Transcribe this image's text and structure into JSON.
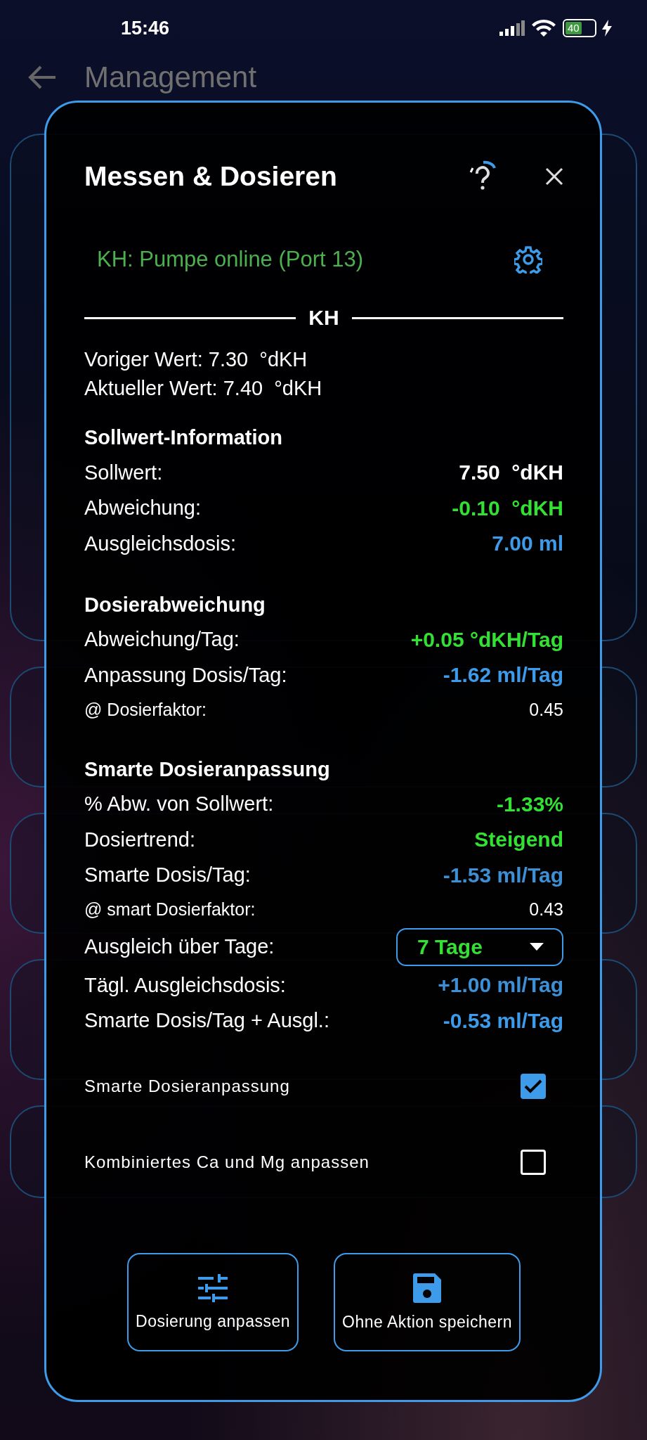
{
  "status_bar": {
    "time": "15:46",
    "battery": "40"
  },
  "header": {
    "title": "Management"
  },
  "dialog": {
    "title": "Messen & Dosieren",
    "status": "KH: Pumpe online (Port 13)",
    "divider_title": "KH",
    "readings": [
      "Voriger Wert: 7.30  °dKH",
      "Aktueller Wert: 7.40  °dKH"
    ],
    "sections": [
      {
        "title": "Sollwert-Information",
        "rows": [
          {
            "kind": "value",
            "label": "Sollwert:",
            "value": "7.50  °dKH",
            "color": "#ffffff"
          },
          {
            "kind": "value",
            "label": "Abweichung:",
            "value": "-0.10  °dKH",
            "color": "#33e033"
          },
          {
            "kind": "value",
            "label": "Ausgleichsdosis:",
            "value": "7.00 ml",
            "color": "#3d9be9"
          }
        ]
      },
      {
        "title": "Dosierabweichung",
        "rows": [
          {
            "kind": "value",
            "label": "Abweichung/Tag:",
            "value": "+0.05 °dKH/Tag",
            "color": "#33e033"
          },
          {
            "kind": "value",
            "label": "Anpassung Dosis/Tag:",
            "value": "-1.62 ml/Tag",
            "color": "#3d9be9"
          },
          {
            "kind": "small",
            "label": "@ Dosierfaktor:",
            "value": "0.45",
            "color": "#ffffff"
          }
        ]
      },
      {
        "title": "Smarte Dosieranpassung",
        "rows": [
          {
            "kind": "value",
            "label": "% Abw. von Sollwert:",
            "value": "-1.33%",
            "color": "#33e033"
          },
          {
            "kind": "value",
            "label": "Dosiertrend:",
            "value": "Steigend",
            "color": "#33e033"
          },
          {
            "kind": "value",
            "label": "Smarte Dosis/Tag:",
            "value": "-1.53 ml/Tag",
            "color": "#3d8fd6"
          },
          {
            "kind": "small",
            "label": "@ smart Dosierfaktor:",
            "value": "0.43",
            "color": "#ffffff"
          },
          {
            "kind": "dropdown",
            "label": "Ausgleich über Tage:",
            "value": "7 Tage",
            "color": "#33e033"
          },
          {
            "kind": "value",
            "label": "Tägl. Ausgleichsdosis:",
            "value": "+1.00 ml/Tag",
            "color": "#3d8fd6"
          },
          {
            "kind": "value",
            "label": "Smarte Dosis/Tag + Ausgl.:",
            "value": "-0.53 ml/Tag",
            "color": "#3d9be9"
          }
        ]
      }
    ],
    "checkboxes": [
      {
        "label": "Smarte Dosieranpassung",
        "checked": true
      },
      {
        "label": "Kombiniertes Ca und Mg anpassen",
        "checked": false
      }
    ],
    "buttons": [
      {
        "label": "Dosierung anpassen"
      },
      {
        "label": "Ohne Aktion speichern"
      }
    ]
  }
}
